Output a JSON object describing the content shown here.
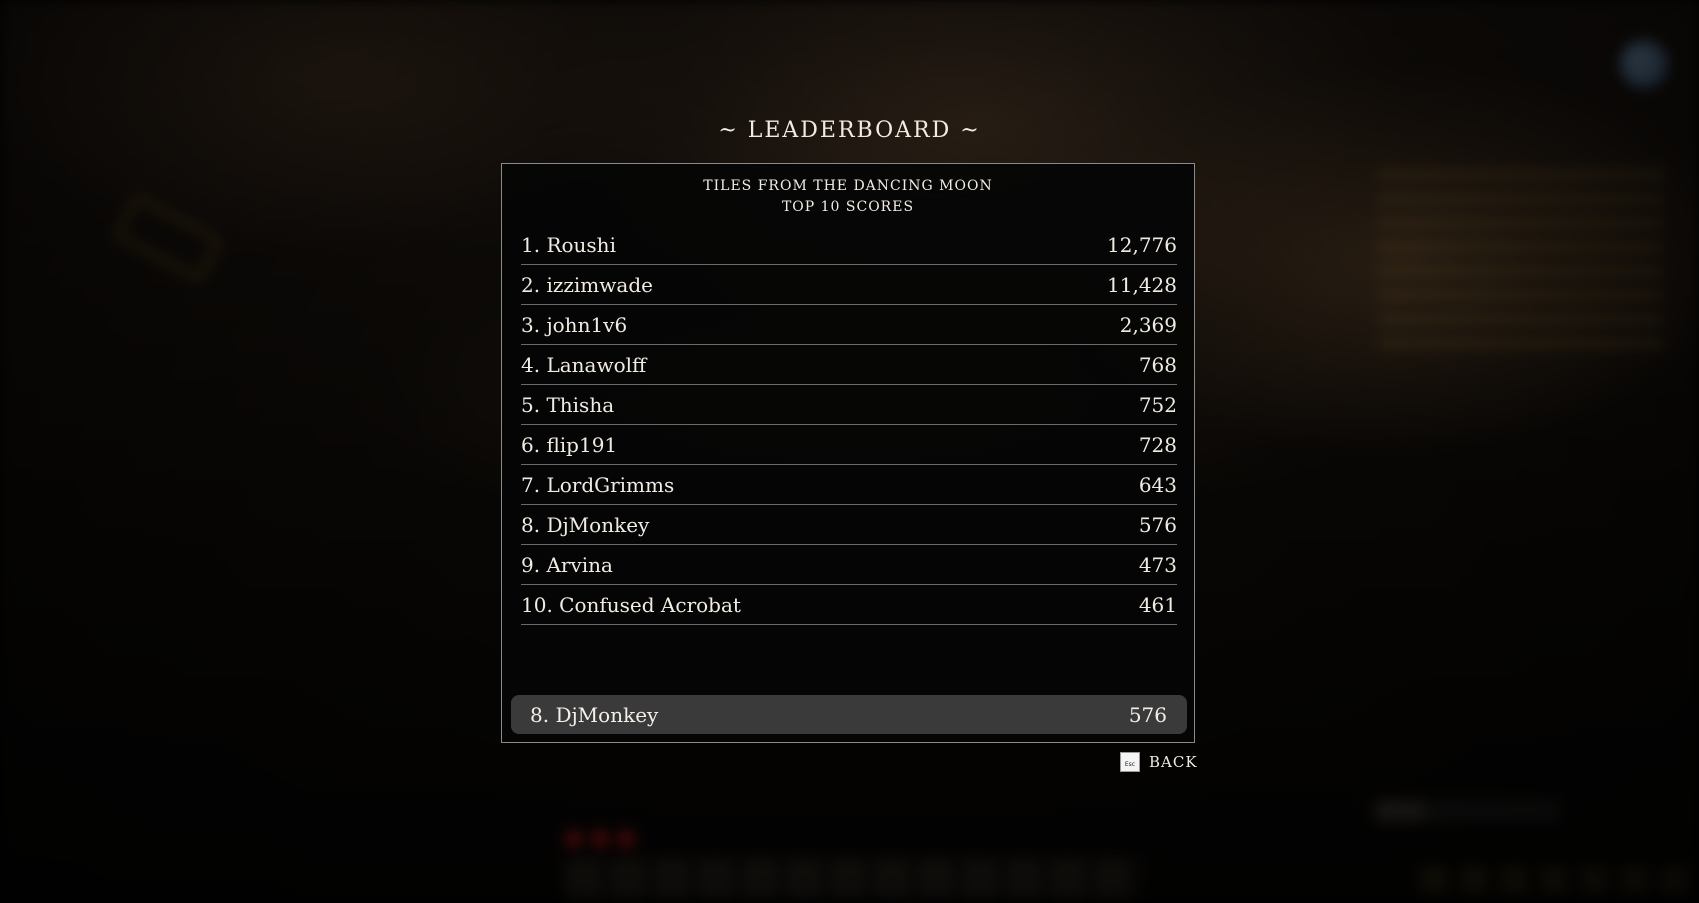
{
  "title": "~ LEADERBOARD ~",
  "panel": {
    "game_name": "TILES FROM THE DANCING MOON",
    "subtitle": "TOP 10 SCORES"
  },
  "entries": [
    {
      "label": "1. Roushi",
      "score": "12,776"
    },
    {
      "label": "2. izzimwade",
      "score": "11,428"
    },
    {
      "label": "3. john1v6",
      "score": "2,369"
    },
    {
      "label": "4. Lanawolff",
      "score": "768"
    },
    {
      "label": "5. Thisha",
      "score": "752"
    },
    {
      "label": "6. flip191",
      "score": "728"
    },
    {
      "label": "7. LordGrimms",
      "score": "643"
    },
    {
      "label": "8. DjMonkey",
      "score": "576"
    },
    {
      "label": "9. Arvina",
      "score": "473"
    },
    {
      "label": "10. Confused Acrobat",
      "score": "461"
    }
  ],
  "player": {
    "label": "8. DjMonkey",
    "score": "576"
  },
  "back": {
    "key": "Esc",
    "label": "BACK"
  },
  "colors": {
    "text": "#f1ece3",
    "panel_border": "#8a8a8a",
    "highlight_row": "#3a3a3a"
  }
}
